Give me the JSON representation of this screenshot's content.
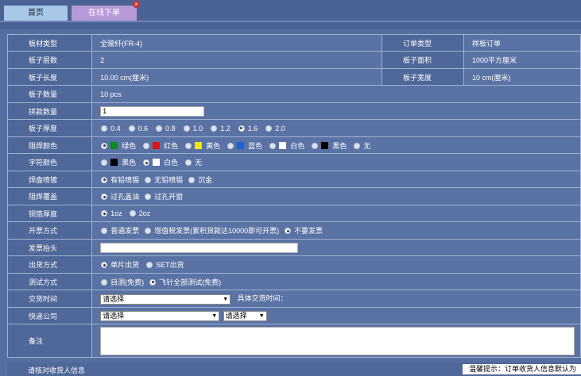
{
  "tabs": {
    "home": "首页",
    "order": "在线下单",
    "close": "×"
  },
  "rows": {
    "board_type": {
      "label": "板材类型",
      "value": "全玻纤(FR-4)"
    },
    "order_type": {
      "label": "订单类型",
      "value": "样板订单"
    },
    "layers": {
      "label": "板子层数",
      "value": "2"
    },
    "area": {
      "label": "板子面积",
      "value": "1000平方厘米"
    },
    "length": {
      "label": "板子长度",
      "value": "10.00 cm(厘米)"
    },
    "width": {
      "label": "板子宽度",
      "value": "10 cm(厘米)"
    },
    "quantity": {
      "label": "板子数量",
      "value": "10 pcs"
    },
    "panel": {
      "label": "拼款数量",
      "value": "1"
    },
    "thickness": {
      "label": "板子厚度",
      "options": [
        "0.4",
        "0.6",
        "0.8",
        "1.0",
        "1.2",
        "1.6",
        "2.0"
      ],
      "selected": 5
    },
    "solder_mask": {
      "label": "阻焊颜色",
      "options": [
        {
          "text": "绿色",
          "color": "#0a8a1e"
        },
        {
          "text": "红色",
          "color": "#e01010"
        },
        {
          "text": "黄色",
          "color": "#f2e600"
        },
        {
          "text": "蓝色",
          "color": "#1565d8"
        },
        {
          "text": "白色",
          "color": "#ffffff"
        },
        {
          "text": "黑色",
          "color": "#000000"
        },
        {
          "text": "无",
          "color": ""
        }
      ],
      "selected": 0
    },
    "silkscreen": {
      "label": "字符颜色",
      "options": [
        {
          "text": "黑色",
          "color": "#000000"
        },
        {
          "text": "白色",
          "color": "#ffffff"
        },
        {
          "text": "无",
          "color": ""
        }
      ],
      "selected": 1
    },
    "surface": {
      "label": "焊盘喷镀",
      "options": [
        "有铅喷锡",
        "无铅喷锡",
        "沉金"
      ],
      "selected": 0
    },
    "via": {
      "label": "阻焊覆盖",
      "options": [
        "过孔盖油",
        "过孔开窗"
      ],
      "selected": 0
    },
    "copper": {
      "label": "铜箔厚度",
      "options": [
        "1oz",
        "2oz"
      ],
      "selected": 0
    },
    "invoice": {
      "label": "开票方式",
      "options": [
        "普通发票",
        "增值税发票(累积货款达10000即可开票)",
        "不要发票"
      ],
      "selected": 2
    },
    "invoice_title": {
      "label": "发票抬头",
      "value": ""
    },
    "shipping": {
      "label": "出货方式",
      "options": [
        "单片出货",
        "SET出货"
      ],
      "selected": 0
    },
    "testing": {
      "label": "测试方式",
      "options": [
        "目测(免费)",
        "飞针全部测试(免费)"
      ],
      "selected": 1
    },
    "delivery": {
      "label": "交货时间",
      "select": "请选择",
      "extra": "具体交货时间："
    },
    "courier": {
      "label": "快递公司",
      "select1": "请选择",
      "select2": "请选择"
    },
    "remarks": {
      "label": "备注"
    }
  },
  "footer": {
    "left": "请核对收货人信息",
    "right": "温馨提示：订单收货人信息默认为"
  }
}
